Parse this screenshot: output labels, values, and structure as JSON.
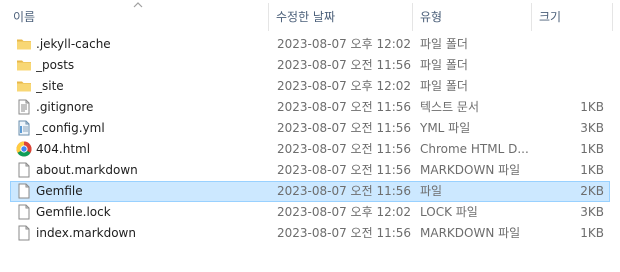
{
  "columns": {
    "name": "이름",
    "date": "수정한 날짜",
    "type": "유형",
    "size": "크기"
  },
  "files": [
    {
      "name": ".jekyll-cache",
      "date": "2023-08-07 오후 12:02",
      "type": "파일 폴더",
      "size": "",
      "icon": "folder-icon"
    },
    {
      "name": "_posts",
      "date": "2023-08-07 오전 11:56",
      "type": "파일 폴더",
      "size": "",
      "icon": "folder-icon"
    },
    {
      "name": "_site",
      "date": "2023-08-07 오후 12:02",
      "type": "파일 폴더",
      "size": "",
      "icon": "folder-icon"
    },
    {
      "name": ".gitignore",
      "date": "2023-08-07 오전 11:56",
      "type": "텍스트 문서",
      "size": "1KB",
      "icon": "text-document-icon"
    },
    {
      "name": "_config.yml",
      "date": "2023-08-07 오전 11:56",
      "type": "YML 파일",
      "size": "3KB",
      "icon": "yml-file-icon"
    },
    {
      "name": "404.html",
      "date": "2023-08-07 오전 11:56",
      "type": "Chrome HTML D...",
      "size": "1KB",
      "icon": "chrome-icon"
    },
    {
      "name": "about.markdown",
      "date": "2023-08-07 오전 11:56",
      "type": "MARKDOWN 파일",
      "size": "1KB",
      "icon": "blank-file-icon"
    },
    {
      "name": "Gemfile",
      "date": "2023-08-07 오전 11:56",
      "type": "파일",
      "size": "2KB",
      "icon": "blank-file-icon",
      "selected": true
    },
    {
      "name": "Gemfile.lock",
      "date": "2023-08-07 오후 12:02",
      "type": "LOCK 파일",
      "size": "3KB",
      "icon": "blank-file-icon"
    },
    {
      "name": "index.markdown",
      "date": "2023-08-07 오전 11:56",
      "type": "MARKDOWN 파일",
      "size": "1KB",
      "icon": "blank-file-icon"
    }
  ],
  "colors": {
    "selection_bg": "#cce8ff",
    "selection_border": "#99d1ff",
    "folder": "#f8d775"
  }
}
